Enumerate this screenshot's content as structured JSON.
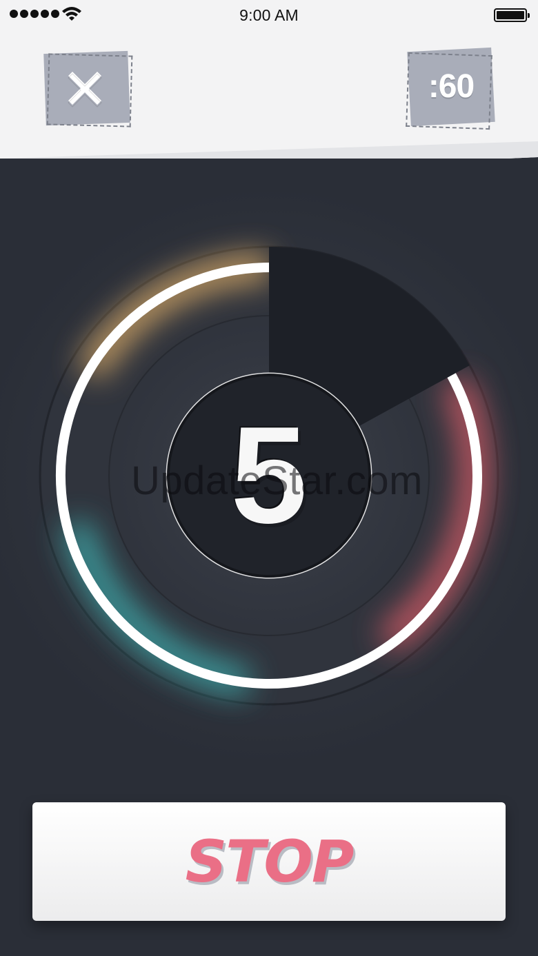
{
  "status_bar": {
    "time": "9:00 AM",
    "icons": [
      "signal-icon",
      "wifi-icon",
      "battery-icon"
    ]
  },
  "header": {
    "close_icon": "close-icon",
    "timer_label": ":60"
  },
  "dial": {
    "countdown": "5",
    "watermark": "UpdateStar.com",
    "progress_fraction": 0.83,
    "colors": {
      "ring_top": "#f2c98a",
      "ring_left": "#4cc6c4",
      "ring_right": "#f06f76",
      "ring_core": "#ffffff",
      "background": "#2a2e37"
    }
  },
  "stop_button": {
    "label": "STOP",
    "color": "#ea6f86"
  }
}
